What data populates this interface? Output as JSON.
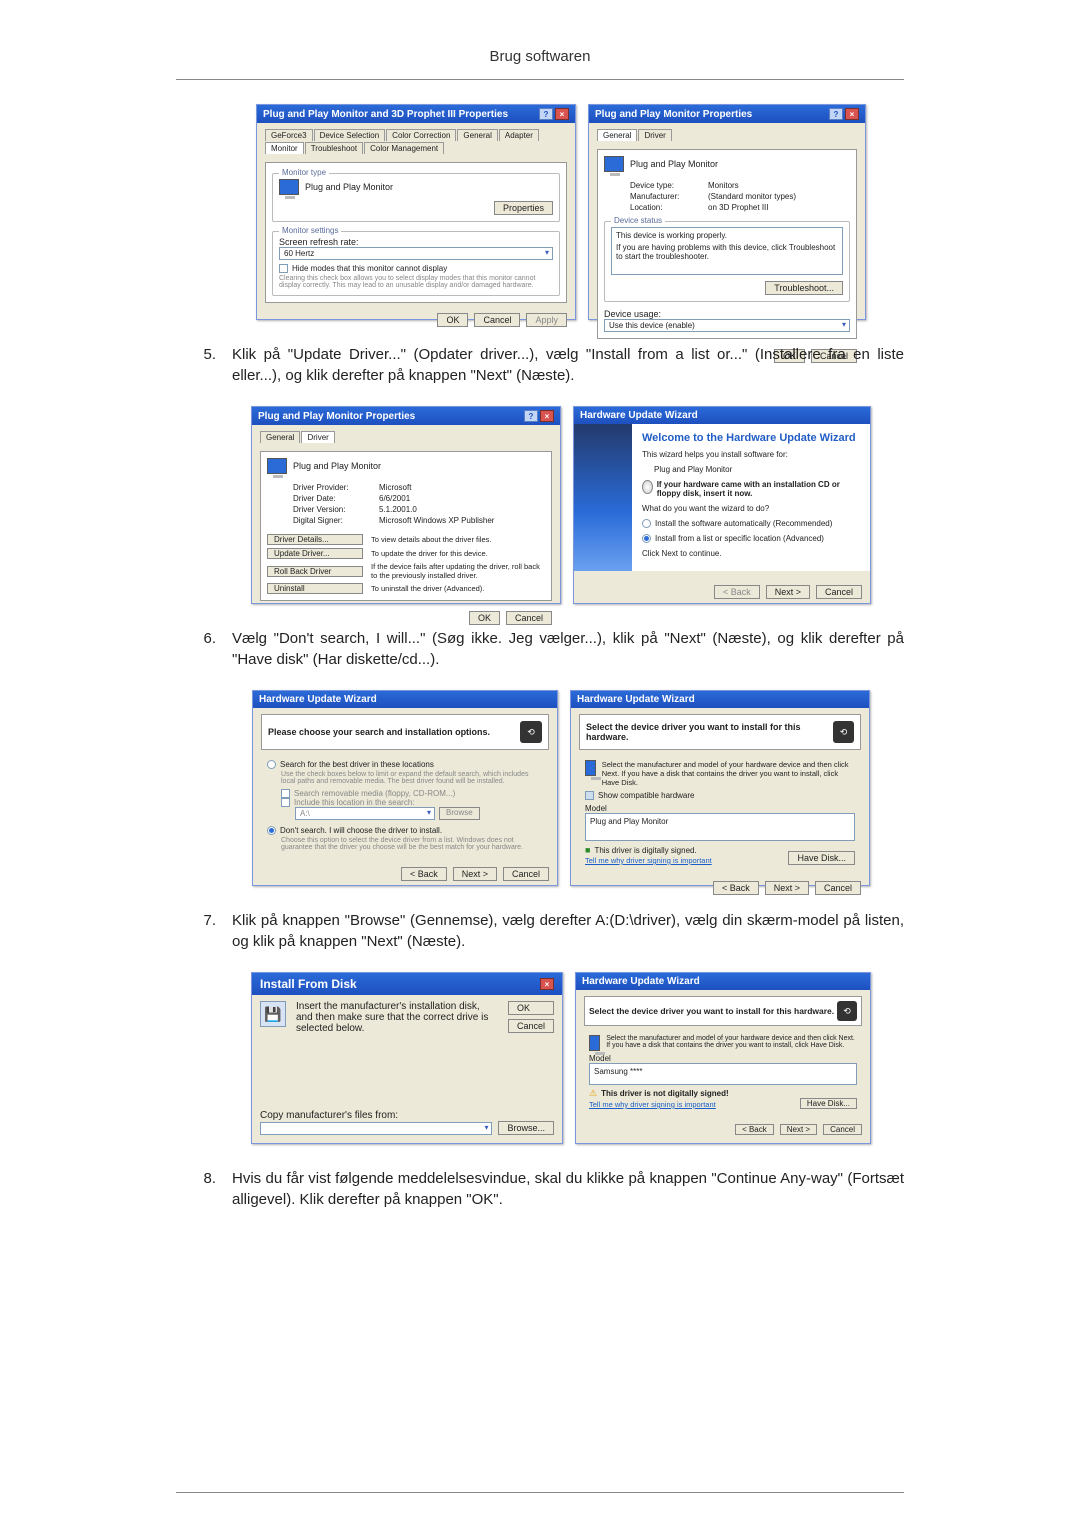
{
  "header": "Brug softwaren",
  "step5_num": "5.",
  "step5_text": "Klik på \"Update Driver...\" (Opdater driver...), vælg \"Install from a list or...\" (Installere fra en liste eller...), og klik derefter på knappen \"Next\" (Næste).",
  "step6_num": "6.",
  "step6_text": "Vælg \"Don't search, I will...\" (Søg ikke. Jeg vælger...), klik på \"Next\" (Næste), og klik derefter på \"Have disk\" (Har diskette/cd...).",
  "step7_num": "7.",
  "step7_text": "Klik på knappen \"Browse\" (Gennemse), vælg derefter A:(D:\\driver), vælg din skærm-model på listen, og klik på knappen \"Next\" (Næste).",
  "step8_num": "8.",
  "step8_text": "Hvis du får vist følgende meddelelsesvindue, skal du klikke på knappen \"Continue Any-way\" (Fortsæt alligevel). Klik derefter på knappen \"OK\".",
  "dlg1_title": "Plug and Play Monitor and 3D Prophet III Properties",
  "dlg1_tabs": [
    "GeForce3",
    "Device Selection",
    "Color Correction",
    "General",
    "Adapter",
    "Monitor",
    "Troubleshoot",
    "Color Management"
  ],
  "dlg1_montype_legend": "Monitor type",
  "dlg1_montype_value": "Plug and Play Monitor",
  "dlg1_properties_btn": "Properties",
  "dlg1_monset_legend": "Monitor settings",
  "dlg1_refresh_label": "Screen refresh rate:",
  "dlg1_refresh_value": "60 Hertz",
  "dlg1_hidecheck": "Hide modes that this monitor cannot display",
  "dlg1_hidehelp": "Clearing this check box allows you to select display modes that this monitor cannot display correctly. This may lead to an unusable display and/or damaged hardware.",
  "ok": "OK",
  "cancel": "Cancel",
  "apply": "Apply",
  "dlg2_title": "Plug and Play Monitor Properties",
  "dlg2_tabs": [
    "General",
    "Driver"
  ],
  "dlg2_head": "Plug and Play Monitor",
  "dlg2_devtype_l": "Device type:",
  "dlg2_devtype_v": "Monitors",
  "dlg2_manu_l": "Manufacturer:",
  "dlg2_manu_v": "(Standard monitor types)",
  "dlg2_loc_l": "Location:",
  "dlg2_loc_v": "on 3D Prophet III",
  "dlg2_status_legend": "Device status",
  "dlg2_status_line1": "This device is working properly.",
  "dlg2_status_line2": "If you are having problems with this device, click Troubleshoot to start the troubleshooter.",
  "dlg2_troubleshoot": "Troubleshoot...",
  "dlg2_usage_l": "Device usage:",
  "dlg2_usage_v": "Use this device (enable)",
  "dlg3_title": "Plug and Play Monitor Properties",
  "dlg3_tabs": [
    "General",
    "Driver"
  ],
  "dlg3_head": "Plug and Play Monitor",
  "dlg3_prov_l": "Driver Provider:",
  "dlg3_prov_v": "Microsoft",
  "dlg3_date_l": "Driver Date:",
  "dlg3_date_v": "6/6/2001",
  "dlg3_ver_l": "Driver Version:",
  "dlg3_ver_v": "5.1.2001.0",
  "dlg3_sig_l": "Digital Signer:",
  "dlg3_sig_v": "Microsoft Windows XP Publisher",
  "dlg3_details_btn": "Driver Details...",
  "dlg3_details_txt": "To view details about the driver files.",
  "dlg3_update_btn": "Update Driver...",
  "dlg3_update_txt": "To update the driver for this device.",
  "dlg3_roll_btn": "Roll Back Driver",
  "dlg3_roll_txt": "If the device fails after updating the driver, roll back to the previously installed driver.",
  "dlg3_uninst_btn": "Uninstall",
  "dlg3_uninst_txt": "To uninstall the driver (Advanced).",
  "dlg4_title": "Hardware Update Wizard",
  "dlg4_heading": "Welcome to the Hardware Update Wizard",
  "dlg4_line1": "This wizard helps you install software for:",
  "dlg4_line2": "Plug and Play Monitor",
  "dlg4_cd": "If your hardware came with an installation CD or floppy disk, insert it now.",
  "dlg4_what": "What do you want the wizard to do?",
  "dlg4_opt1": "Install the software automatically (Recommended)",
  "dlg4_opt2": "Install from a list or specific location (Advanced)",
  "dlg4_click": "Click Next to continue.",
  "back": "< Back",
  "next": "Next >",
  "dlg5_title": "Hardware Update Wizard",
  "dlg5_heading": "Please choose your search and installation options.",
  "dlg5_opt1": "Search for the best driver in these locations",
  "dlg5_opt1_help": "Use the check boxes below to limit or expand the default search, which includes local paths and removable media. The best driver found will be installed.",
  "dlg5_chk1": "Search removable media (floppy, CD-ROM...)",
  "dlg5_chk2": "Include this location in the search:",
  "dlg5_path": "A:\\",
  "dlg5_browse": "Browse",
  "dlg5_opt2": "Don't search. I will choose the driver to install.",
  "dlg5_opt2_help": "Choose this option to select the device driver from a list. Windows does not guarantee that the driver you choose will be the best match for your hardware.",
  "dlg6_title": "Hardware Update Wizard",
  "dlg6_heading": "Select the device driver you want to install for this hardware.",
  "dlg6_help": "Select the manufacturer and model of your hardware device and then click Next. If you have a disk that contains the driver you want to install, click Have Disk.",
  "dlg6_showcompat": "Show compatible hardware",
  "dlg6_model_l": "Model",
  "dlg6_model_v": "Plug and Play Monitor",
  "dlg6_signed": "This driver is digitally signed.",
  "dlg6_tellme": "Tell me why driver signing is important",
  "dlg6_havedisk": "Have Disk...",
  "dlg7_title": "Install From Disk",
  "dlg7_help": "Insert the manufacturer's installation disk, and then make sure that the correct drive is selected below.",
  "dlg7_copy_l": "Copy manufacturer's files from:",
  "dlg7_browse": "Browse...",
  "dlg8_title": "Hardware Update Wizard",
  "dlg8_heading": "Select the device driver you want to install for this hardware.",
  "dlg8_help": "Select the manufacturer and model of your hardware device and then click Next. If you have a disk that contains the driver you want to install, click Have Disk.",
  "dlg8_model_l": "Model",
  "dlg8_model_v": "Samsung ****",
  "dlg8_notsigned": "This driver is not digitally signed!",
  "dlg8_tellme": "Tell me why driver signing is important",
  "dlg8_havedisk": "Have Disk...",
  "chart_data": null
}
